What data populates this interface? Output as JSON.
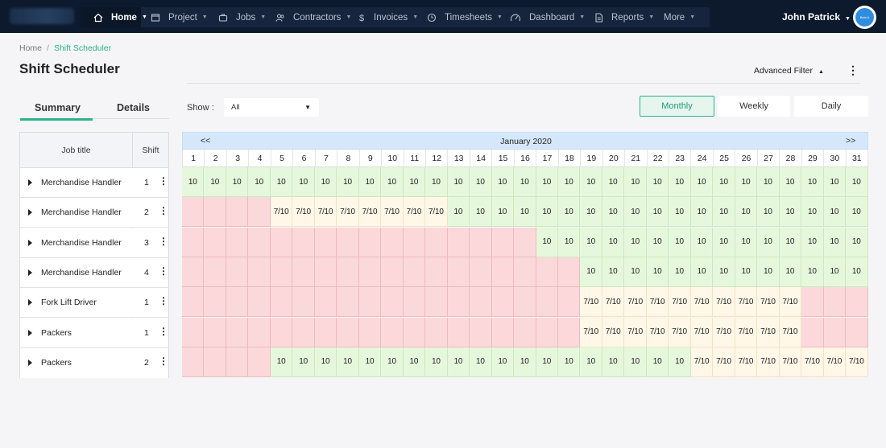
{
  "nav": {
    "items": [
      {
        "label": "Home",
        "icon": "home-icon",
        "active": true,
        "width": 75
      },
      {
        "label": "Project",
        "icon": "project-icon",
        "active": false,
        "width": 84
      },
      {
        "label": "Jobs",
        "icon": "jobs-icon",
        "active": false,
        "width": 71
      },
      {
        "label": "Contractors",
        "icon": "contractors-icon",
        "active": false,
        "width": 104
      },
      {
        "label": "Invoices",
        "icon": "invoices-icon",
        "active": false,
        "width": 84
      },
      {
        "label": "Timesheets",
        "icon": "timesheets-icon",
        "active": false,
        "width": 103
      },
      {
        "label": "Dashboard",
        "icon": "dashboard-icon",
        "active": false,
        "width": 105
      },
      {
        "label": "Reports",
        "icon": "reports-icon",
        "active": false,
        "width": 86
      },
      {
        "label": "More",
        "icon": "",
        "active": false,
        "width": 69
      }
    ],
    "user_name": "John Patrick",
    "avatar_text": "Bela A"
  },
  "breadcrumb": {
    "home": "Home",
    "separator": "/",
    "current": "Shift Scheduler"
  },
  "page_title": "Shift Scheduler",
  "advanced_filter": "Advanced Filter",
  "tabs": {
    "summary": "Summary",
    "details": "Details"
  },
  "show": {
    "label": "Show :",
    "value": "All"
  },
  "views": {
    "monthly": "Monthly",
    "weekly": "Weekly",
    "daily": "Daily",
    "active": "monthly"
  },
  "table": {
    "headers": {
      "job_title": "Job title",
      "shift": "Shift"
    },
    "rows": [
      {
        "job": "Merchandise Handler",
        "shift": "1"
      },
      {
        "job": "Merchandise Handler",
        "shift": "2"
      },
      {
        "job": "Merchandise Handler",
        "shift": "3"
      },
      {
        "job": "Merchandise Handler",
        "shift": "4"
      },
      {
        "job": "Fork Lift Driver",
        "shift": "1"
      },
      {
        "job": "Packers",
        "shift": "1"
      },
      {
        "job": "Packers",
        "shift": "2"
      }
    ]
  },
  "calendar": {
    "month": "January 2020",
    "prev": "<<",
    "next": ">>",
    "days": 31,
    "legend_colors": {
      "filled": "#e6f8dc",
      "partial": "#fff7e7",
      "empty": "#fbd9db"
    },
    "rows": [
      [
        "10",
        "10",
        "10",
        "10",
        "10",
        "10",
        "10",
        "10",
        "10",
        "10",
        "10",
        "10",
        "10",
        "10",
        "10",
        "10",
        "10",
        "10",
        "10",
        "10",
        "10",
        "10",
        "10",
        "10",
        "10",
        "10",
        "10",
        "10",
        "10",
        "10",
        "10"
      ],
      [
        "",
        "",
        "",
        "",
        "7/10",
        "7/10",
        "7/10",
        "7/10",
        "7/10",
        "7/10",
        "7/10",
        "7/10",
        "10",
        "10",
        "10",
        "10",
        "10",
        "10",
        "10",
        "10",
        "10",
        "10",
        "10",
        "10",
        "10",
        "10",
        "10",
        "10",
        "10",
        "10",
        "10"
      ],
      [
        "",
        "",
        "",
        "",
        "",
        "",
        "",
        "",
        "",
        "",
        "",
        "",
        "",
        "",
        "",
        "",
        "10",
        "10",
        "10",
        "10",
        "10",
        "10",
        "10",
        "10",
        "10",
        "10",
        "10",
        "10",
        "10",
        "10",
        "10"
      ],
      [
        "",
        "",
        "",
        "",
        "",
        "",
        "",
        "",
        "",
        "",
        "",
        "",
        "",
        "",
        "",
        "",
        "",
        "",
        "10",
        "10",
        "10",
        "10",
        "10",
        "10",
        "10",
        "10",
        "10",
        "10",
        "10",
        "10",
        "10"
      ],
      [
        "",
        "",
        "",
        "",
        "",
        "",
        "",
        "",
        "",
        "",
        "",
        "",
        "",
        "",
        "",
        "",
        "",
        "",
        "7/10",
        "7/10",
        "7/10",
        "7/10",
        "7/10",
        "7/10",
        "7/10",
        "7/10",
        "7/10",
        "7/10",
        "",
        "",
        ""
      ],
      [
        "",
        "",
        "",
        "",
        "",
        "",
        "",
        "",
        "",
        "",
        "",
        "",
        "",
        "",
        "",
        "",
        "",
        "",
        "7/10",
        "7/10",
        "7/10",
        "7/10",
        "7/10",
        "7/10",
        "7/10",
        "7/10",
        "7/10",
        "7/10",
        "",
        "",
        ""
      ],
      [
        "",
        "",
        "",
        "",
        "10",
        "10",
        "10",
        "10",
        "10",
        "10",
        "10",
        "10",
        "10",
        "10",
        "10",
        "10",
        "10",
        "10",
        "10",
        "10",
        "10",
        "10",
        "10",
        "7/10",
        "7/10",
        "7/10",
        "7/10",
        "7/10",
        "7/10",
        "7/10",
        "7/10"
      ]
    ]
  }
}
